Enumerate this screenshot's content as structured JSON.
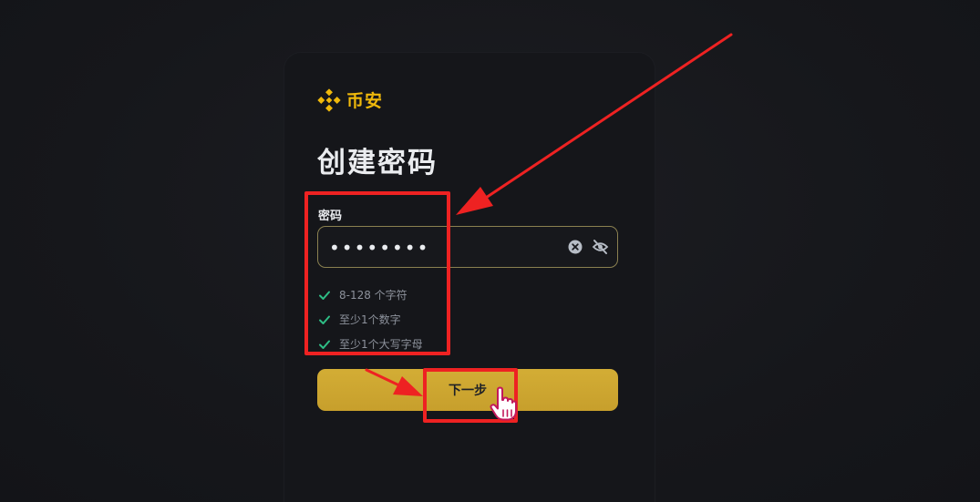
{
  "brand": {
    "name": "币安",
    "color": "#f0b90b",
    "logo_icon": "binance-diamond-icon"
  },
  "page": {
    "title": "创建密码"
  },
  "password": {
    "label": "密码",
    "value": "••••••••",
    "clear_icon": "clear-icon",
    "visibility_icon": "eye-off-icon"
  },
  "rules": [
    {
      "text": "8-128 个字符",
      "met": true
    },
    {
      "text": "至少1个数字",
      "met": true
    },
    {
      "text": "至少1个大写字母",
      "met": true
    }
  ],
  "actions": {
    "next_label": "下一步"
  },
  "annotations": {
    "color": "#ee2222",
    "cursor_icon": "hand-pointer-icon"
  }
}
